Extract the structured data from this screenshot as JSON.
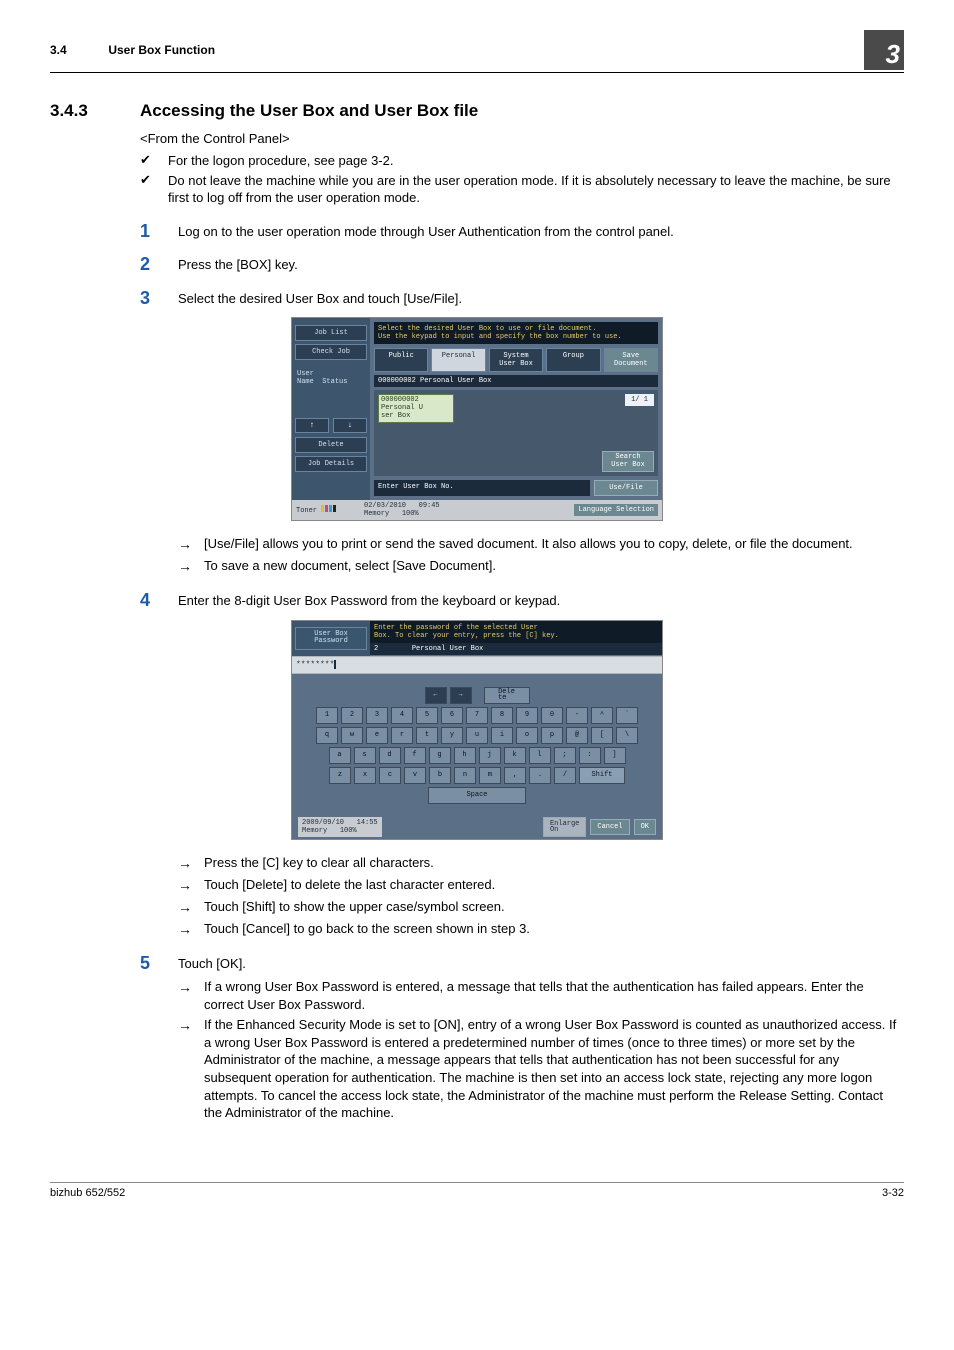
{
  "header": {
    "section_number": "3.4",
    "section_title": "User Box Function",
    "chapter_number": "3"
  },
  "heading": {
    "number": "3.4.3",
    "title": "Accessing the User Box and User Box file"
  },
  "intro_line": "<From the Control Panel>",
  "checks": [
    "For the logon procedure, see page 3-2.",
    "Do not leave the machine while you are in the user operation mode. If it is absolutely necessary to leave the machine, be sure first to log off from the user operation mode."
  ],
  "steps": {
    "s1": "Log on to the user operation mode through User Authentication from the control panel.",
    "s2": "Press the [BOX] key.",
    "s3": "Select the desired User Box and touch [Use/File].",
    "s4": "Enter the 8-digit User Box Password from the keyboard or keypad.",
    "s5": "Touch [OK]."
  },
  "arrows3": [
    "[Use/File] allows you to print or send the saved document. It also allows you to copy, delete, or file the document.",
    "To save a new document, select [Save Document]."
  ],
  "arrows4": [
    "Press the [C] key to clear all characters.",
    "Touch [Delete] to delete the last character entered.",
    "Touch [Shift] to show the upper case/symbol screen.",
    "Touch [Cancel] to go back to the screen shown in step 3."
  ],
  "arrows5": [
    "If a wrong User Box Password is entered, a message that tells that the authentication has failed appears. Enter the correct User Box Password.",
    "If the Enhanced Security Mode is set to [ON], entry of a wrong User Box Password is counted as unauthorized access. If a wrong User Box Password is entered a predetermined number of times (once to three times) or more set by the Administrator of the machine, a message appears that tells that authentication has not been successful for any subsequent operation for authentication. The machine is then set into an access lock state, rejecting any more logon attempts. To cancel the access lock state, the Administrator of the machine must perform the Release Setting. Contact the Administrator of the machine."
  ],
  "ss1": {
    "side": {
      "job_list": "Job List",
      "check_job": "Check Job",
      "user_name": "User\nName",
      "status": "Status",
      "delete": "Delete",
      "job_details": "Job Details"
    },
    "hint": "Select the desired User Box to use or file document.\nUse the keypad to input and specify the box number to use.",
    "tabs": {
      "public": "Public",
      "personal": "Personal",
      "system": "System\nUser Box",
      "group": "Group",
      "save": "Save Document"
    },
    "subbar": "000000002  Personal User Box",
    "box_card": "000000002\nPersonal U\nser Box",
    "page": "1/  1",
    "search": "Search\nUser Box",
    "enter_no": "Enter User Box No.",
    "usefile": "Use/File",
    "footer": {
      "toner": "Toner",
      "date": "02/03/2010",
      "time": "09:45",
      "memory": "Memory",
      "mempct": "100%",
      "lang": "Language Selection"
    }
  },
  "ss2": {
    "side": "User Box\nPassword",
    "hint": "Enter the password of the selected User\nBox. To clear your entry, press the [C] key.",
    "subline_num": "2",
    "subline_name": "Personal User Box",
    "pw_masked": "********",
    "nav_left": "←",
    "nav_right": "→",
    "delete": "Dele\nte",
    "row1": [
      "1",
      "2",
      "3",
      "4",
      "5",
      "6",
      "7",
      "8",
      "9",
      "0",
      "-",
      "^",
      "`"
    ],
    "row2": [
      "q",
      "w",
      "e",
      "r",
      "t",
      "y",
      "u",
      "i",
      "o",
      "p",
      "@",
      "[",
      "\\"
    ],
    "row3": [
      "a",
      "s",
      "d",
      "f",
      "g",
      "h",
      "j",
      "k",
      "l",
      ";",
      ":",
      "]"
    ],
    "row4": [
      "z",
      "x",
      "c",
      "v",
      "b",
      "n",
      "m",
      ",",
      ".",
      "/"
    ],
    "shift": "Shift",
    "space": "Space",
    "enlarge": "Enlarge\nOn",
    "cancel": "Cancel",
    "ok": "OK",
    "footer": {
      "date": "2009/09/10",
      "time": "14:55",
      "memory": "Memory",
      "mempct": "100%"
    }
  },
  "footer": {
    "left": "bizhub 652/552",
    "right": "3-32"
  }
}
